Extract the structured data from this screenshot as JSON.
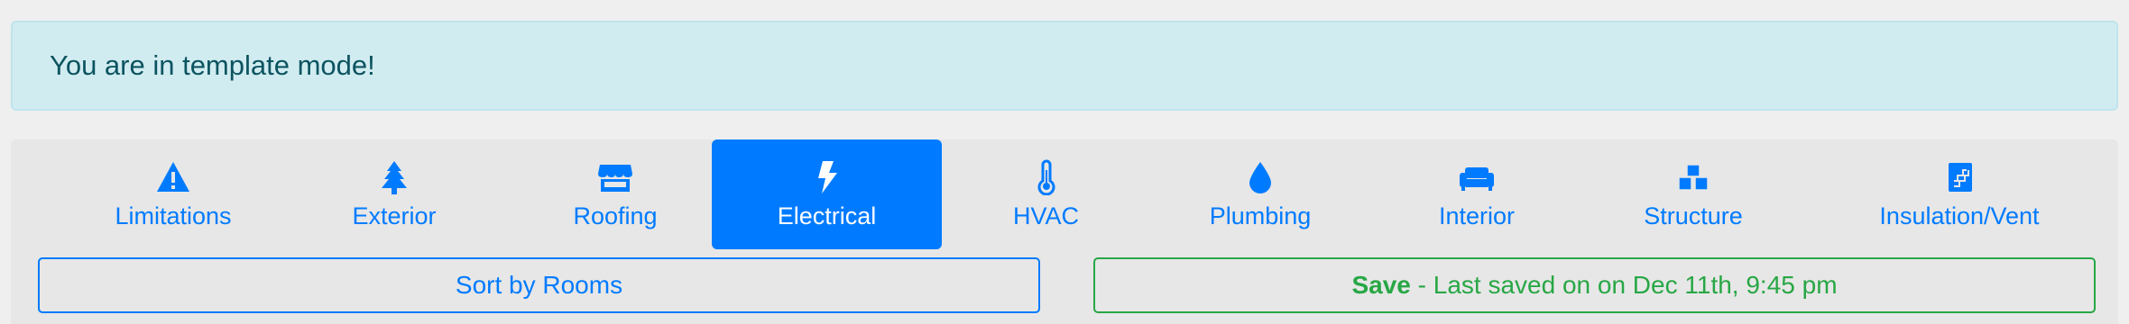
{
  "alert": {
    "text": "You are in template mode!"
  },
  "tabs": [
    {
      "label": "Limitations",
      "icon": "warning-triangle-icon",
      "active": false
    },
    {
      "label": "Exterior",
      "icon": "tree-icon",
      "active": false
    },
    {
      "label": "Roofing",
      "icon": "storefront-icon",
      "active": false
    },
    {
      "label": "Electrical",
      "icon": "lightning-bolt-icon",
      "active": true
    },
    {
      "label": "HVAC",
      "icon": "thermometer-icon",
      "active": false
    },
    {
      "label": "Plumbing",
      "icon": "water-drop-icon",
      "active": false
    },
    {
      "label": "Interior",
      "icon": "couch-icon",
      "active": false
    },
    {
      "label": "Structure",
      "icon": "cubes-icon",
      "active": false
    },
    {
      "label": "Insulation/Vent",
      "icon": "insulation-icon",
      "active": false
    }
  ],
  "sort_button": {
    "label": "Sort by Rooms"
  },
  "save_button": {
    "strong": "Save",
    "status": " - Last saved on on Dec 11th, 9:45 pm"
  },
  "colors": {
    "primary": "#007bff",
    "success": "#28a745",
    "info_bg": "#d1ecf1",
    "info_text": "#0c5460"
  }
}
